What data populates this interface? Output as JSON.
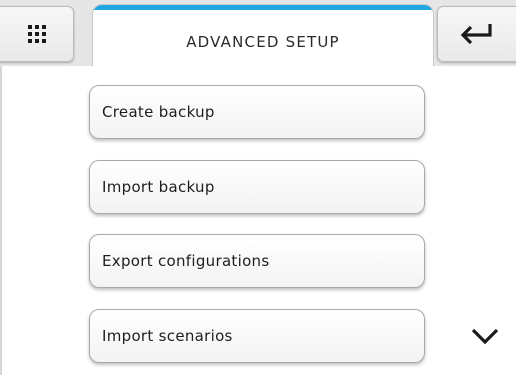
{
  "header": {
    "title": "ADVANCED SETUP",
    "accent_color": "#1ea7e1",
    "left_button_icon": "grid-icon",
    "right_button_icon": "return-arrow-icon"
  },
  "menu": {
    "items": [
      {
        "label": "Create backup"
      },
      {
        "label": "Import backup"
      },
      {
        "label": "Export configurations"
      },
      {
        "label": "Import scenarios"
      }
    ],
    "scroll_icon": "chevron-down-icon"
  }
}
